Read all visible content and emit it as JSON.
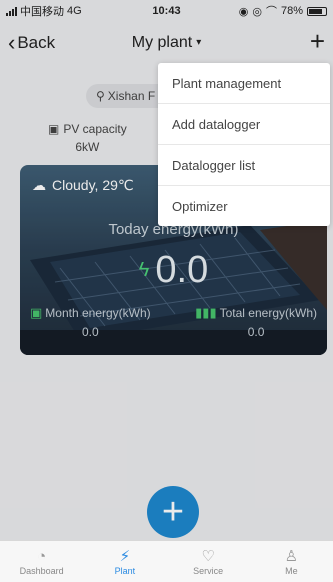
{
  "status_bar": {
    "carrier": "中国移动",
    "network": "4G",
    "time": "10:43",
    "battery": "78%"
  },
  "nav": {
    "back_label": "Back",
    "title": "My plant"
  },
  "plant": {
    "location": "Xishan F",
    "pv_capacity_label": "PV capacity",
    "pv_capacity_value": "6kW"
  },
  "card": {
    "weather": "Cloudy,  29℃",
    "today_label": "Today energy(kWh)",
    "today_value": "0.0",
    "month_label": "Month energy(kWh)",
    "month_value": "0.0",
    "total_label": "Total energy(kWh)",
    "total_value": "0.0"
  },
  "menu": {
    "items": [
      {
        "label": "Plant management"
      },
      {
        "label": "Add datalogger"
      },
      {
        "label": "Datalogger list"
      },
      {
        "label": "Optimizer"
      }
    ]
  },
  "tabbar": {
    "tabs": [
      {
        "label": "Dashboard",
        "icon": "dashboard-icon"
      },
      {
        "label": "Plant",
        "icon": "plant-icon",
        "active": true
      },
      {
        "label": "Service",
        "icon": "service-icon"
      },
      {
        "label": "Me",
        "icon": "me-icon"
      }
    ]
  },
  "colors": {
    "accent": "#2b8be2",
    "fab": "#1e88cf",
    "energy_icon": "#4cd27a"
  }
}
